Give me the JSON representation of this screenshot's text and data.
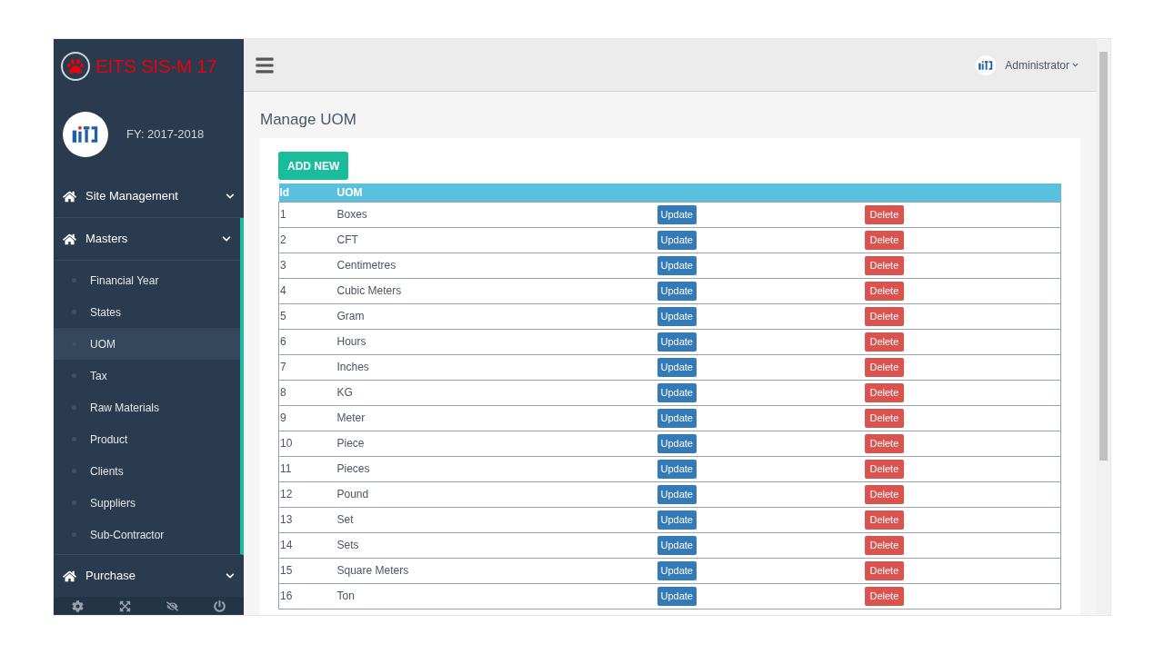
{
  "brand": {
    "title": "EITS SIS-M 17"
  },
  "profile": {
    "fiscal_year": "FY: 2017-2018"
  },
  "sidebar": {
    "items": [
      {
        "label": "Site Management",
        "expanded": false
      },
      {
        "label": "Masters",
        "expanded": true,
        "children": [
          {
            "label": "Financial Year",
            "selected": false
          },
          {
            "label": "States",
            "selected": false
          },
          {
            "label": "UOM",
            "selected": true
          },
          {
            "label": "Tax",
            "selected": false
          },
          {
            "label": "Raw Materials",
            "selected": false
          },
          {
            "label": "Product",
            "selected": false
          },
          {
            "label": "Clients",
            "selected": false
          },
          {
            "label": "Suppliers",
            "selected": false
          },
          {
            "label": "Sub-Contractor",
            "selected": false
          }
        ]
      },
      {
        "label": "Purchase",
        "expanded": false
      }
    ]
  },
  "header": {
    "user": "Administrator"
  },
  "page": {
    "title": "Manage UOM",
    "add_button": "ADD NEW"
  },
  "table": {
    "columns": [
      "Id",
      "UOM"
    ],
    "rows": [
      {
        "id": "1",
        "uom": "Boxes",
        "update": "Update",
        "delete": "Delete"
      },
      {
        "id": "2",
        "uom": "CFT",
        "update": "Update",
        "delete": "Delete"
      },
      {
        "id": "3",
        "uom": "Centimetres",
        "update": "Update",
        "delete": "Delete"
      },
      {
        "id": "4",
        "uom": "Cubic Meters",
        "update": "Update",
        "delete": "Delete"
      },
      {
        "id": "5",
        "uom": "Gram",
        "update": "Update",
        "delete": "Delete"
      },
      {
        "id": "6",
        "uom": "Hours",
        "update": "Update",
        "delete": "Delete"
      },
      {
        "id": "7",
        "uom": "Inches",
        "update": "Update",
        "delete": "Delete"
      },
      {
        "id": "8",
        "uom": "KG",
        "update": "Update",
        "delete": "Delete"
      },
      {
        "id": "9",
        "uom": "Meter",
        "update": "Update",
        "delete": "Delete"
      },
      {
        "id": "10",
        "uom": "Piece",
        "update": "Update",
        "delete": "Delete"
      },
      {
        "id": "11",
        "uom": "Pieces",
        "update": "Update",
        "delete": "Delete"
      },
      {
        "id": "12",
        "uom": "Pound",
        "update": "Update",
        "delete": "Delete"
      },
      {
        "id": "13",
        "uom": "Set",
        "update": "Update",
        "delete": "Delete"
      },
      {
        "id": "14",
        "uom": "Sets",
        "update": "Update",
        "delete": "Delete"
      },
      {
        "id": "15",
        "uom": "Square Meters",
        "update": "Update",
        "delete": "Delete"
      },
      {
        "id": "16",
        "uom": "Ton",
        "update": "Update",
        "delete": "Delete"
      }
    ]
  }
}
